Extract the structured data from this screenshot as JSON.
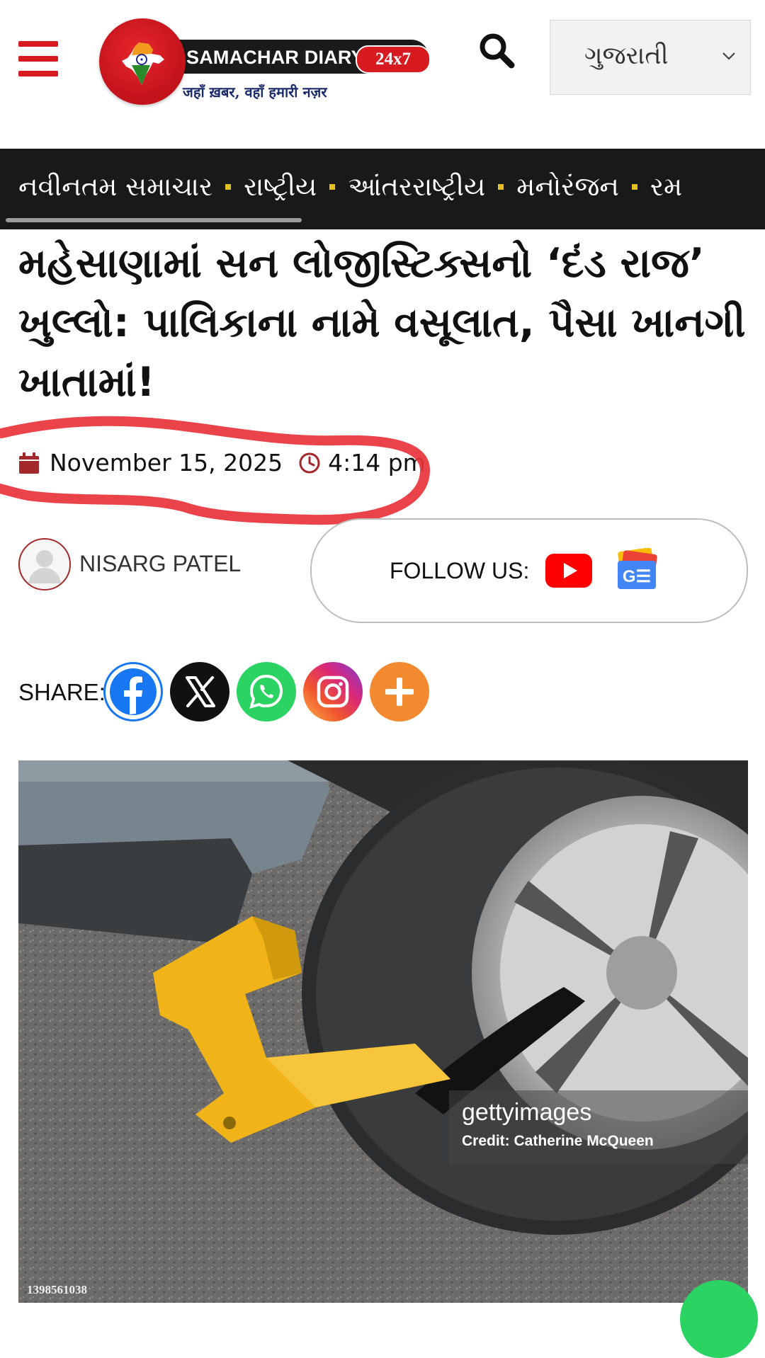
{
  "header": {
    "logo": {
      "name": "SAMACHAR DIARY",
      "tag": "24x7",
      "slogan": "जहाँ ख़बर, वहाँ हमारी नज़र"
    },
    "language_select": {
      "value": "ગુજરાતી"
    },
    "icons": {
      "menu": "hamburger-icon",
      "search": "search-icon",
      "dropdown": "chevron-down-icon"
    },
    "brand_color": "#d71920"
  },
  "nav": {
    "items": [
      "નવીનતમ સમાચાર",
      "રાષ્ટ્રીય",
      "આંતરરાષ્ટ્રીય",
      "મનોરંજન",
      "રમ"
    ],
    "separator_color": "#e2c025"
  },
  "article": {
    "headline": "મહેસાણામાં સન લોજીસ્ટિક્સનો ‘દંડ રાજ’ ખુલ્લો: પાલિકાના નામે વસૂલાત, પૈસા ખાનગી ખાતામાં!",
    "date": "November 15, 2025",
    "time": "4:14 pm",
    "author": "NISARG PATEL",
    "follow_label": "FOLLOW US:",
    "share_label": "SHARE:",
    "share_buttons": [
      "facebook-icon",
      "x-icon",
      "whatsapp-icon",
      "instagram-icon",
      "plus-icon"
    ]
  },
  "image": {
    "watermark": "gettyimages",
    "credit": "Credit: Catherine McQueen",
    "id": "1398561038"
  }
}
